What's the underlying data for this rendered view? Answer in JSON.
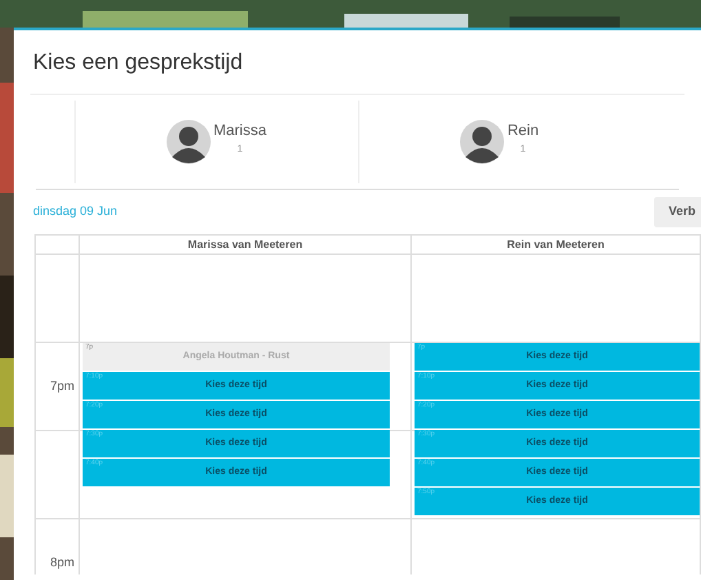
{
  "dialog": {
    "title": "Kies een gesprekstijd"
  },
  "people": [
    {
      "name": "Marissa",
      "count": "1"
    },
    {
      "name": "Rein",
      "count": "1"
    }
  ],
  "date": "dinsdag 09 Jun",
  "button": "Verb",
  "calendar": {
    "time_labels": [
      "7pm",
      "8pm"
    ],
    "columns": [
      {
        "name": "Marissa van Meeteren",
        "slots": [
          {
            "kind": "busy",
            "time": "7p",
            "label": "Angela Houtman - Rust"
          },
          {
            "kind": "free",
            "time": "7:10p",
            "label": "Kies deze tijd"
          },
          {
            "kind": "free",
            "time": "7:20p",
            "label": "Kies deze tijd"
          },
          {
            "kind": "free",
            "time": "7:30p",
            "label": "Kies deze tijd"
          },
          {
            "kind": "free",
            "time": "7:40p",
            "label": "Kies deze tijd"
          }
        ]
      },
      {
        "name": "Rein van Meeteren",
        "slots": [
          {
            "kind": "free",
            "time": "7p",
            "label": "Kies deze tijd"
          },
          {
            "kind": "free",
            "time": "7:10p",
            "label": "Kies deze tijd"
          },
          {
            "kind": "free",
            "time": "7:20p",
            "label": "Kies deze tijd"
          },
          {
            "kind": "free",
            "time": "7:30p",
            "label": "Kies deze tijd"
          },
          {
            "kind": "free",
            "time": "7:40p",
            "label": "Kies deze tijd"
          },
          {
            "kind": "free",
            "time": "7:50p",
            "label": "Kies deze tijd"
          }
        ]
      }
    ]
  }
}
